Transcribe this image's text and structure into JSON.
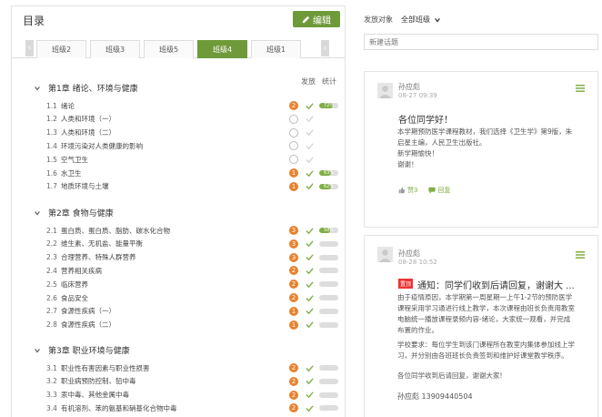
{
  "left": {
    "title": "目录",
    "edit_label": "编辑",
    "tabs": [
      "班级2",
      "班级3",
      "班级5",
      "班级4",
      "班级1"
    ],
    "active_tab": 3,
    "col_publish": "发放",
    "col_stats": "统计"
  },
  "chapters": [
    {
      "title": "第1章 绪论、环境与健康",
      "lessons": [
        {
          "num": "1.1",
          "title": "绪论",
          "count": "2",
          "checked": true,
          "progress": 72,
          "pct_label": "72%"
        },
        {
          "num": "1.2",
          "title": "人类和环境（一）",
          "count": "",
          "checked": false,
          "progress": null,
          "pct_label": ""
        },
        {
          "num": "1.3",
          "title": "人类和环境（二）",
          "count": "",
          "checked": false,
          "progress": null,
          "pct_label": ""
        },
        {
          "num": "1.4",
          "title": "环境污染对人类健康的影响",
          "count": "",
          "checked": false,
          "progress": null,
          "pct_label": ""
        },
        {
          "num": "1.5",
          "title": "空气卫生",
          "count": "",
          "checked": false,
          "progress": null,
          "pct_label": ""
        },
        {
          "num": "1.6",
          "title": "水卫生",
          "count": "1",
          "checked": true,
          "progress": 63,
          "pct_label": "63%"
        },
        {
          "num": "1.7",
          "title": "地质环境与土壤",
          "count": "1",
          "checked": true,
          "progress": 62,
          "pct_label": "62%"
        }
      ]
    },
    {
      "title": "第2章 食物与健康",
      "lessons": [
        {
          "num": "2.1",
          "title": "蛋白质、蛋白质、脂肪、碳水化合物",
          "count": "3",
          "checked": true,
          "progress": 58,
          "pct_label": "58%"
        },
        {
          "num": "2.2",
          "title": "维生素、无机盐、能量平衡",
          "count": "3",
          "checked": true,
          "progress": 0,
          "pct_label": ""
        },
        {
          "num": "2.3",
          "title": "合理营养、特殊人群营养",
          "count": "3",
          "checked": true,
          "progress": 0,
          "pct_label": ""
        },
        {
          "num": "2.4",
          "title": "营养相关疾病",
          "count": "2",
          "checked": true,
          "progress": 0,
          "pct_label": ""
        },
        {
          "num": "2.5",
          "title": "临床营养",
          "count": "2",
          "checked": true,
          "progress": 0,
          "pct_label": ""
        },
        {
          "num": "2.6",
          "title": "食品安全",
          "count": "2",
          "checked": true,
          "progress": 0,
          "pct_label": ""
        },
        {
          "num": "2.7",
          "title": "食源性疾病（一）",
          "count": "1",
          "checked": true,
          "progress": 0,
          "pct_label": ""
        },
        {
          "num": "2.8",
          "title": "食源性疾病（二）",
          "count": "1",
          "checked": true,
          "progress": 0,
          "pct_label": ""
        }
      ]
    },
    {
      "title": "第3章 职业环境与健康",
      "lessons": [
        {
          "num": "3.1",
          "title": "职业性有害因素与职业性损害",
          "count": "2",
          "checked": true,
          "progress": 0,
          "pct_label": ""
        },
        {
          "num": "3.2",
          "title": "职业病预防控制、铅中毒",
          "count": "2",
          "checked": true,
          "progress": 0,
          "pct_label": ""
        },
        {
          "num": "3.3",
          "title": "汞中毒、其他金属中毒",
          "count": "2",
          "checked": true,
          "progress": 0,
          "pct_label": ""
        },
        {
          "num": "3.4",
          "title": "有机溶剂、苯的氨基和硝基化合物中毒",
          "count": "2",
          "checked": true,
          "progress": 0,
          "pct_label": ""
        }
      ]
    }
  ],
  "right": {
    "audience_label": "发放对象",
    "audience_value": "全部班级",
    "topic_placeholder": "新建话题",
    "posts": [
      {
        "author": "孙应彪",
        "time": "08-27 09:39",
        "title": "各位同学好！",
        "body": [
          "本学期预防医学课程教材，我们选择《卫生学》第9版，朱",
          "启星主编，人民卫生出版社。",
          "新学期愉快！",
          "谢谢！"
        ],
        "like_label": "赞3",
        "reply_label": "回复"
      },
      {
        "author": "孙应彪",
        "time": "08-28 10:52",
        "tag": "置顶",
        "title": "通知：同学们收到后请回复，谢谢大 ...",
        "body": [
          "由于疫情原因，本学期第一周星期一上午1-2节的预防医学",
          "课程采用学习通进行线上教学，本次课程由班长负责用教室",
          "电脑统一播放课程录频内容-绪论，大家统一观看，并完成",
          "布置的作业。",
          "学校要求：每位学生到该门课程所在教室内集体参加线上学",
          "习，并分别由各班班长负责签到和维护好课堂教学秩序。",
          "",
          "各位同学收到后请回复，谢谢大家!"
        ],
        "signature": "孙应彪 13909440504"
      }
    ]
  },
  "colors": {
    "accent": "#6f9a3a",
    "badge": "#e8822d",
    "progress": "#7fae45",
    "tag": "#ee3333"
  }
}
